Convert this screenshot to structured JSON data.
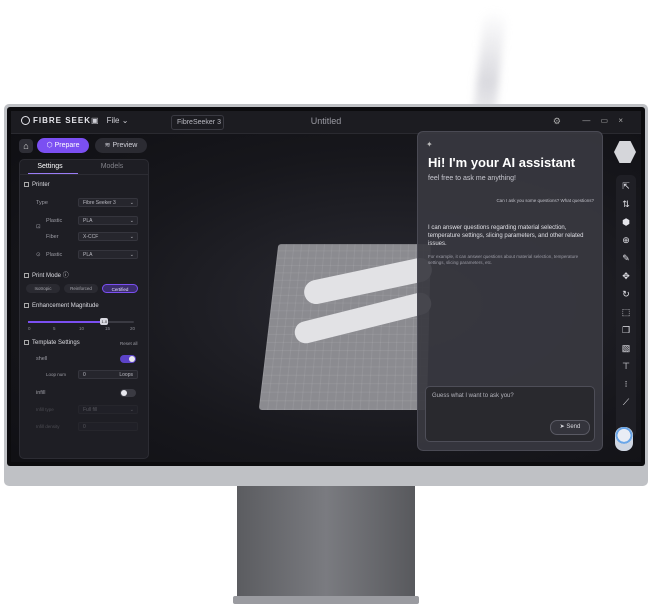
{
  "topbar": {
    "logo": "FIBRE SEEK",
    "file_label": "File",
    "printer": "FibreSeeker 3",
    "window_title": "Untitled",
    "win_controls": "— ▭ ×"
  },
  "modes": {
    "prepare": "Prepare",
    "preview": "Preview"
  },
  "panel": {
    "tab_settings": "Settings",
    "tab_models": "Models",
    "printer_section": "Printer",
    "type_label": "Type",
    "type_value": "Fibre Seeker 3",
    "plastic1_label": "Plastic",
    "plastic1_value": "PLA",
    "fiber_label": "Fiber",
    "fiber_value": "X-CCF",
    "plastic2_label": "Plastic",
    "plastic2_value": "PLA",
    "print_mode_section": "Print Mode",
    "print_modes": [
      "Isotropic",
      "Reinforced",
      "Certified"
    ],
    "enh_section": "Enhancement Magnitude",
    "enh_value": "1.0",
    "enh_ticks": [
      "0",
      "5",
      "10",
      "15",
      "20"
    ],
    "enh_fraction": 0.72,
    "template_section": "Template Settings",
    "template_reset": "Reset all",
    "shell_label": "shell",
    "loop_label": "Loop num",
    "loop_value": "0",
    "loop_unit": "Loops",
    "infill_label": "infill",
    "infill_type_label": "Infill type",
    "infill_type_value": "Full fill",
    "infill_density_label": "Infill density",
    "infill_density_value": "0"
  },
  "ai": {
    "title": "Hi! I'm your AI assistant",
    "subtitle": "feel free to ask me anything!",
    "bubble": "Can I ask you some questions?  What questions?",
    "answer": "I can answer questions regarding material selection, temperature settings, slicing parameters, and other related issues.",
    "example": "For example, it can answer questions about material selection, temperature settings, slicing parameters, etc.",
    "placeholder": "Guess what I want to ask you?",
    "send": "Send"
  },
  "colors": {
    "accent": "#7b4ff2"
  }
}
